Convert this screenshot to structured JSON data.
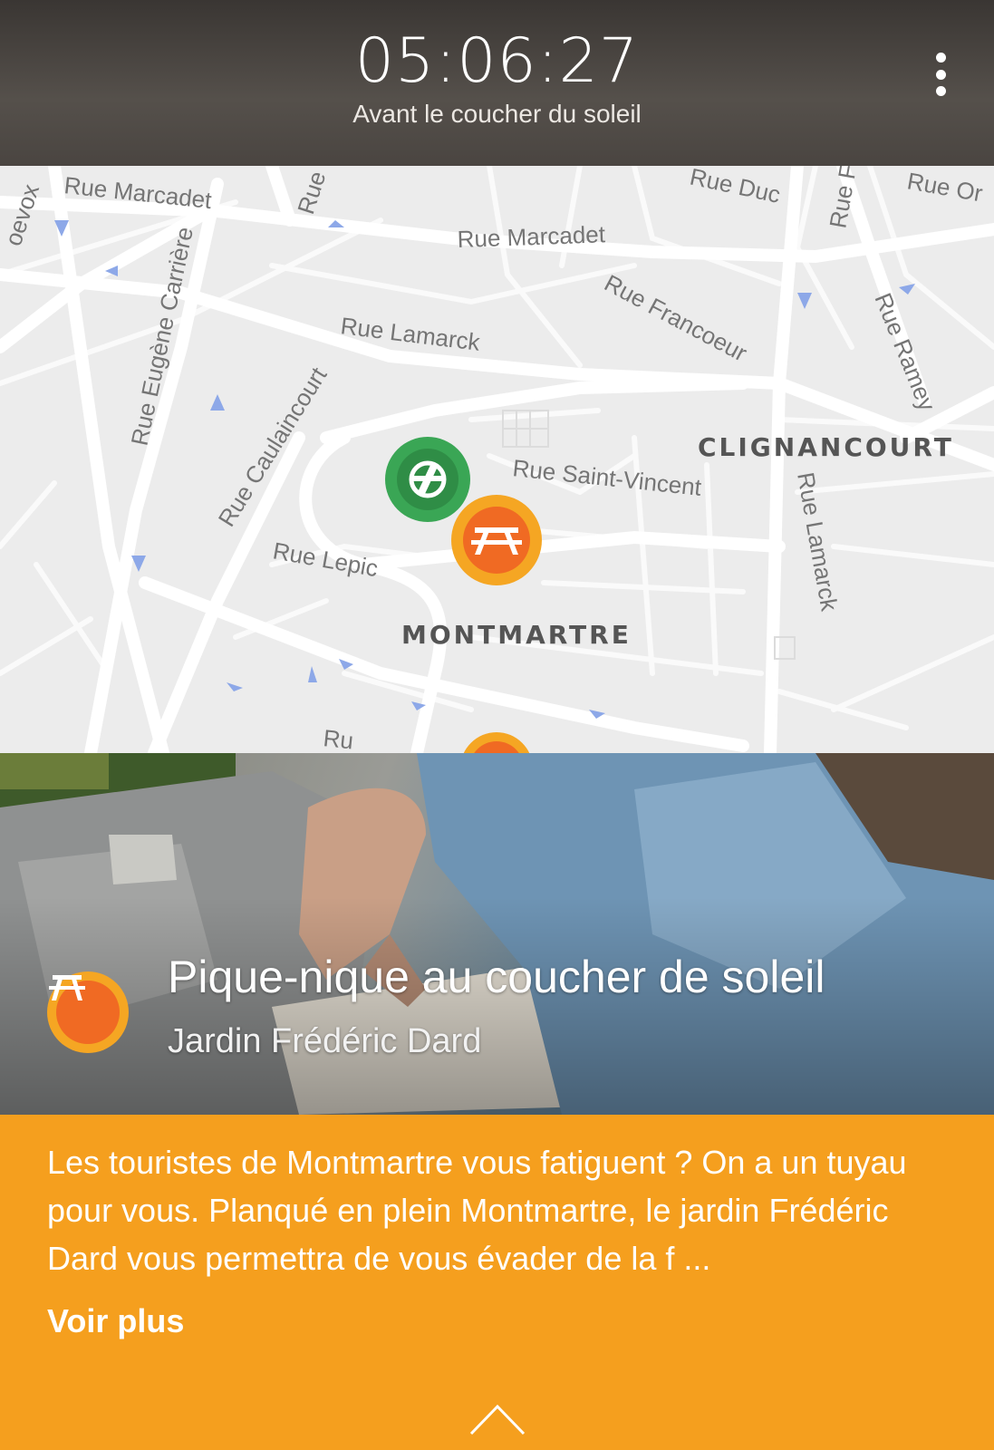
{
  "header": {
    "time": "05:06:27",
    "subtitle": "Avant le coucher du soleil",
    "menu_icon": "more-vert-icon"
  },
  "map": {
    "streets": [
      "Rue Marcadet",
      "Rue Marcadet",
      "Rue Lamarck",
      "Rue Francoeur",
      "Rue Eugène Carrière",
      "Rue Caulaincourt",
      "Rue Saint-Vincent",
      "Rue Lepic",
      "Rue Lamarck",
      "Rue Ramey",
      "Rue Duc",
      "Rue Or",
      "Rue",
      "Rue F",
      "Ru",
      "oevox"
    ],
    "districts": [
      "CLIGNANCOURT",
      "MONTMARTRE"
    ],
    "markers": [
      "globe-marker-icon",
      "picnic-marker-icon",
      "picnic-marker-icon"
    ]
  },
  "event": {
    "title": "Pique-nique au coucher de soleil",
    "place": "Jardin Frédéric Dard",
    "icon": "picnic-table-icon"
  },
  "description": {
    "text": "Les touristes de Montmartre vous fatiguent ? On a un tuyau pour vous. Planqué en plein Montmartre, le jardin Frédéric Dard vous permettra de vous évader de la f ...",
    "more_label": "Voir plus",
    "expand_icon": "chevron-up-icon"
  },
  "colors": {
    "accent_orange": "#f59f1e",
    "marker_orange": "#f06a23",
    "marker_green": "#3aa655",
    "header_dark": "#4a4541"
  }
}
